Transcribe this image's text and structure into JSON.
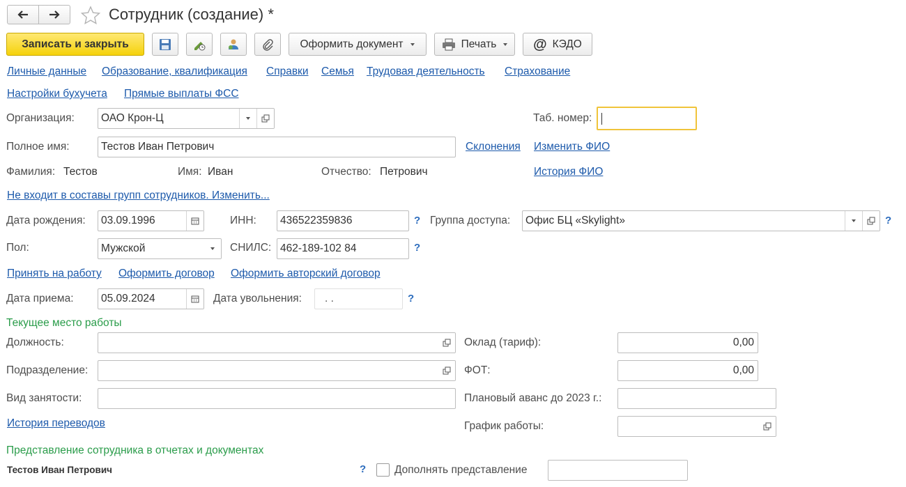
{
  "window": {
    "title": "Сотрудник (создание) *",
    "favorite_icon": "star-icon"
  },
  "toolbar": {
    "save_close": "Записать и закрыть",
    "create_document": "Оформить документ",
    "print": "Печать",
    "kedo": "КЭДО"
  },
  "tabs_row1": [
    "Личные данные",
    "Образование, квалификация",
    "Справки",
    "Семья",
    "Трудовая деятельность",
    "Страхование"
  ],
  "tabs_row2": [
    "Настройки бухучета",
    "Прямые выплаты ФСС"
  ],
  "org": {
    "label": "Организация:",
    "value": "ОАО Крон-Ц"
  },
  "tab_number": {
    "label": "Таб. номер:",
    "value": ""
  },
  "full_name": {
    "label": "Полное имя:",
    "value": "Тестов Иван Петрович",
    "declensions": "Склонения",
    "change_fio": "Изменить ФИО",
    "fio_history": "История ФИО"
  },
  "name_parts": {
    "surname_label": "Фамилия:",
    "surname": "Тестов",
    "name_label": "Имя:",
    "name": "Иван",
    "patronymic_label": "Отчество:",
    "patronymic": "Петрович"
  },
  "groups_link": "Не входит в составы групп сотрудников. Изменить...",
  "birth": {
    "label": "Дата рождения:",
    "value": "03.09.1996"
  },
  "inn": {
    "label": "ИНН:",
    "value": "436522359836"
  },
  "access_group": {
    "label": "Группа доступа:",
    "value": "Офис БЦ «Skylight»"
  },
  "gender": {
    "label": "Пол:",
    "value": "Мужской"
  },
  "snils": {
    "label": "СНИЛС:",
    "value": "462-189-102 84"
  },
  "help_mark": "?",
  "actions": {
    "hire": "Принять на работу",
    "contract": "Оформить договор",
    "author_contract": "Оформить авторский договор"
  },
  "hire_date": {
    "label": "Дата приема:",
    "value": "05.09.2024"
  },
  "dismissal_date": {
    "label": "Дата увольнения:",
    "value": " .  ."
  },
  "current_job": {
    "header": "Текущее место работы",
    "position_label": "Должность:",
    "position": "",
    "department_label": "Подразделение:",
    "department": "",
    "employment_label": "Вид занятости:",
    "employment": "",
    "transfer_history": "История переводов",
    "salary_label": "Оклад (тариф):",
    "salary": "0,00",
    "fot_label": "ФОТ:",
    "fot": "0,00",
    "advance_label": "Плановый аванс до 2023 г.:",
    "advance": "",
    "schedule_label": "График работы:",
    "schedule": ""
  },
  "representation": {
    "header": "Представление сотрудника в отчетах и документах",
    "value": "Тестов Иван Петрович",
    "extend_label": "Дополнять представление",
    "extend_checked": false,
    "extend_value": ""
  }
}
